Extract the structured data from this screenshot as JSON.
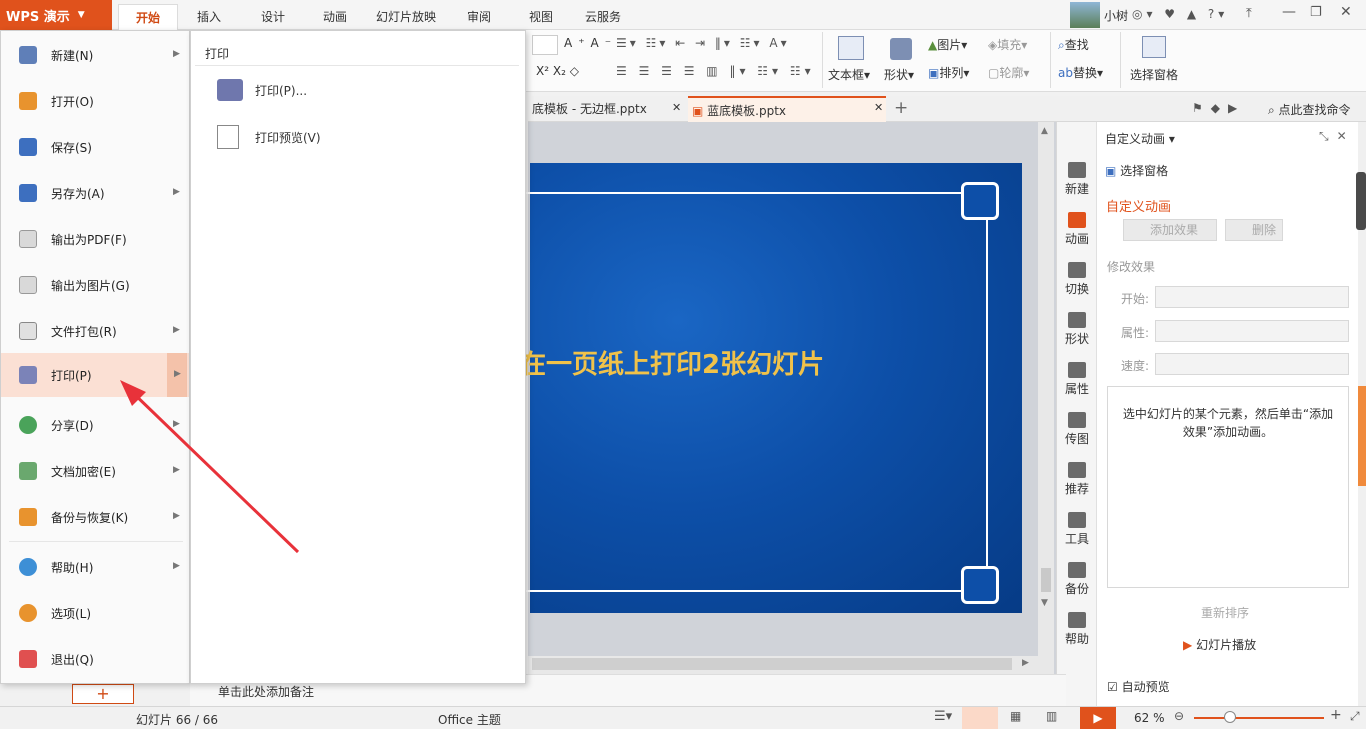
{
  "app": {
    "logo": "WPS 演示",
    "accent": "#e0521c",
    "user": "小树"
  },
  "tabs": [
    "开始",
    "插入",
    "设计",
    "动画",
    "幻灯片放映",
    "审阅",
    "视图",
    "云服务"
  ],
  "ribbon": {
    "textbox": "文本框",
    "shape": "形状",
    "picture": "图片",
    "arrange": "排列",
    "fill": "填充",
    "outline": "轮廓",
    "find": "查找",
    "replace": "替换",
    "select_pane": "选择窗格"
  },
  "doc_tabs": [
    "底模板 - 无边框.pptx",
    "蓝底模板.pptx"
  ],
  "search": "点此查找命令",
  "menu": {
    "items": [
      "新建(N)",
      "打开(O)",
      "保存(S)",
      "另存为(A)",
      "输出为PDF(F)",
      "输出为图片(G)",
      "文件打包(R)",
      "打印(P)",
      "分享(D)",
      "文档加密(E)",
      "备份与恢复(K)",
      "帮助(H)",
      "选项(L)",
      "退出(Q)"
    ]
  },
  "submenu": {
    "title": "打印",
    "items": [
      "打印(P)...",
      "打印预览(V)"
    ]
  },
  "slide": {
    "title": "在一页纸上打印2张幻灯片"
  },
  "side_tabs": [
    "新建",
    "动画",
    "切换",
    "形状",
    "属性",
    "传图",
    "推荐",
    "工具",
    "备份",
    "帮助"
  ],
  "panel": {
    "header": "自定义动画",
    "select_pane": "选择窗格",
    "section": "自定义动画",
    "add_effect": "添加效果",
    "delete": "删除",
    "modify": "修改效果",
    "start": "开始:",
    "property": "属性:",
    "speed": "速度:",
    "hint": "选中幻灯片的某个元素，然后单击“添加效果”添加动画。",
    "reorder": "重新排序",
    "play": "幻灯片播放",
    "autopreview": "自动预览"
  },
  "notes": "单击此处添加备注",
  "status": {
    "slides": "幻灯片 66 / 66",
    "theme": "Office 主题",
    "zoom": "62 %"
  }
}
